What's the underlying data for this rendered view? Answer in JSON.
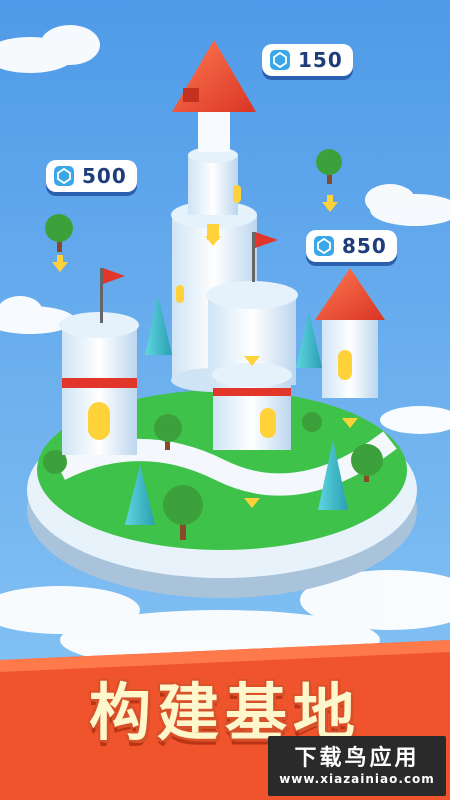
{
  "price_tags": [
    {
      "amount": "150",
      "icon": "gem-icon"
    },
    {
      "amount": "500",
      "icon": "gem-icon"
    },
    {
      "amount": "850",
      "icon": "gem-icon"
    }
  ],
  "banner": {
    "title": "构建基地"
  },
  "watermark": {
    "text": "下载鸟应用",
    "url": "www.xiazainiao.com"
  },
  "colors": {
    "sky": "#5aa6f0",
    "grass": "#3fc24a",
    "banner": "#f0542d",
    "roof": "#e5432f",
    "tag_text": "#1f3d7a"
  }
}
